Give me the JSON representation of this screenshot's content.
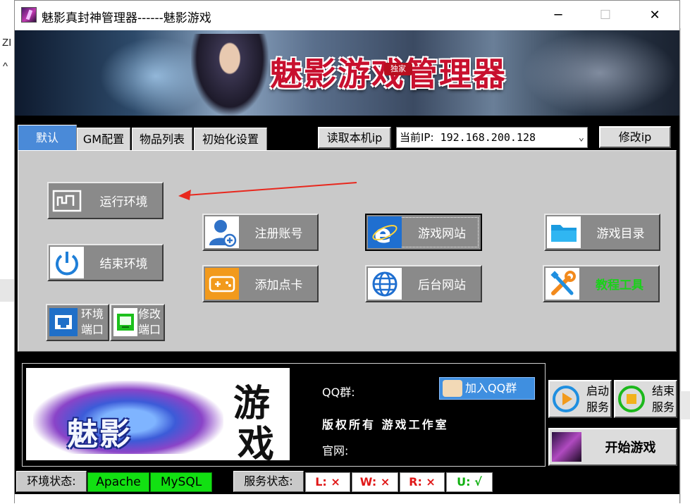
{
  "window": {
    "title": "魅影真封神管理器------魅影游戏",
    "minimize": "─",
    "maximize": "☐",
    "close": "✕"
  },
  "background": {
    "left_char_1": "ZI",
    "left_char_2": "^"
  },
  "banner": {
    "title": "魅影游戏管理器",
    "tag": "独家"
  },
  "tabs": [
    {
      "label": "默认",
      "active": true
    },
    {
      "label": "GM配置",
      "active": false
    },
    {
      "label": "物品列表",
      "active": false
    },
    {
      "label": "初始化设置",
      "active": false
    }
  ],
  "ip": {
    "read_button": "读取本机ip",
    "label": "当前IP:",
    "value": "192.168.200.128",
    "modify_button": "修改ip"
  },
  "actions": {
    "run_env": "运行环境",
    "stop_env": "结束环境",
    "env_port": [
      "环境",
      "端口"
    ],
    "modify_port": [
      "修改",
      "端口"
    ],
    "register": "注册账号",
    "add_card": "添加点卡",
    "game_site": "游戏网站",
    "admin_site": "后台网站",
    "game_dir": "游戏目录",
    "tools": "教程工具"
  },
  "info": {
    "logo_main": "魅影",
    "logo_you": "游",
    "logo_xi": "戏",
    "qq_label": "QQ群:",
    "qq_button": "加入QQ群",
    "copyright": "版权所有 游戏工作室",
    "website_label": "官网:"
  },
  "service": {
    "start": [
      "启动",
      "服务"
    ],
    "stop": [
      "结束",
      "服务"
    ],
    "start_game": "开始游戏"
  },
  "status": {
    "env_label": "环境状态:",
    "apache": "Apache",
    "mysql": "MySQL",
    "service_label": "服务状态:",
    "l": "L: ×",
    "w": "W: ×",
    "r": "R: ×",
    "u": "U: √"
  },
  "colors": {
    "active_tab": "#4a8ad8",
    "status_on": "#12e012",
    "status_off": "#e01818",
    "tools_text": "#19d219"
  }
}
